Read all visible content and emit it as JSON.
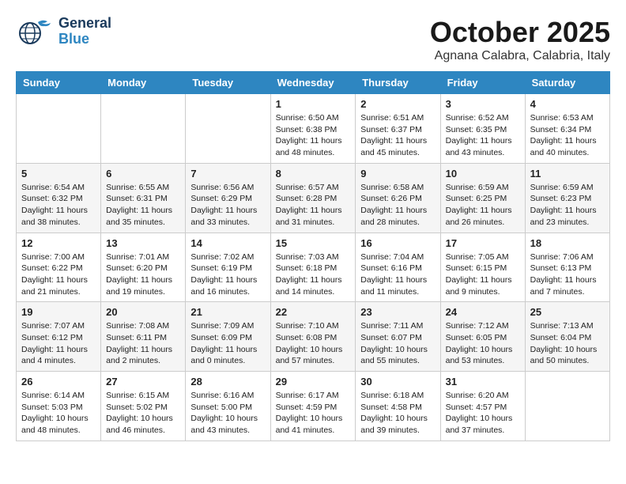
{
  "header": {
    "logo": {
      "line1": "General",
      "line2": "Blue"
    },
    "month": "October 2025",
    "location": "Agnana Calabra, Calabria, Italy"
  },
  "weekdays": [
    "Sunday",
    "Monday",
    "Tuesday",
    "Wednesday",
    "Thursday",
    "Friday",
    "Saturday"
  ],
  "weeks": [
    [
      {
        "day": "",
        "info": ""
      },
      {
        "day": "",
        "info": ""
      },
      {
        "day": "",
        "info": ""
      },
      {
        "day": "1",
        "info": "Sunrise: 6:50 AM\nSunset: 6:38 PM\nDaylight: 11 hours\nand 48 minutes."
      },
      {
        "day": "2",
        "info": "Sunrise: 6:51 AM\nSunset: 6:37 PM\nDaylight: 11 hours\nand 45 minutes."
      },
      {
        "day": "3",
        "info": "Sunrise: 6:52 AM\nSunset: 6:35 PM\nDaylight: 11 hours\nand 43 minutes."
      },
      {
        "day": "4",
        "info": "Sunrise: 6:53 AM\nSunset: 6:34 PM\nDaylight: 11 hours\nand 40 minutes."
      }
    ],
    [
      {
        "day": "5",
        "info": "Sunrise: 6:54 AM\nSunset: 6:32 PM\nDaylight: 11 hours\nand 38 minutes."
      },
      {
        "day": "6",
        "info": "Sunrise: 6:55 AM\nSunset: 6:31 PM\nDaylight: 11 hours\nand 35 minutes."
      },
      {
        "day": "7",
        "info": "Sunrise: 6:56 AM\nSunset: 6:29 PM\nDaylight: 11 hours\nand 33 minutes."
      },
      {
        "day": "8",
        "info": "Sunrise: 6:57 AM\nSunset: 6:28 PM\nDaylight: 11 hours\nand 31 minutes."
      },
      {
        "day": "9",
        "info": "Sunrise: 6:58 AM\nSunset: 6:26 PM\nDaylight: 11 hours\nand 28 minutes."
      },
      {
        "day": "10",
        "info": "Sunrise: 6:59 AM\nSunset: 6:25 PM\nDaylight: 11 hours\nand 26 minutes."
      },
      {
        "day": "11",
        "info": "Sunrise: 6:59 AM\nSunset: 6:23 PM\nDaylight: 11 hours\nand 23 minutes."
      }
    ],
    [
      {
        "day": "12",
        "info": "Sunrise: 7:00 AM\nSunset: 6:22 PM\nDaylight: 11 hours\nand 21 minutes."
      },
      {
        "day": "13",
        "info": "Sunrise: 7:01 AM\nSunset: 6:20 PM\nDaylight: 11 hours\nand 19 minutes."
      },
      {
        "day": "14",
        "info": "Sunrise: 7:02 AM\nSunset: 6:19 PM\nDaylight: 11 hours\nand 16 minutes."
      },
      {
        "day": "15",
        "info": "Sunrise: 7:03 AM\nSunset: 6:18 PM\nDaylight: 11 hours\nand 14 minutes."
      },
      {
        "day": "16",
        "info": "Sunrise: 7:04 AM\nSunset: 6:16 PM\nDaylight: 11 hours\nand 11 minutes."
      },
      {
        "day": "17",
        "info": "Sunrise: 7:05 AM\nSunset: 6:15 PM\nDaylight: 11 hours\nand 9 minutes."
      },
      {
        "day": "18",
        "info": "Sunrise: 7:06 AM\nSunset: 6:13 PM\nDaylight: 11 hours\nand 7 minutes."
      }
    ],
    [
      {
        "day": "19",
        "info": "Sunrise: 7:07 AM\nSunset: 6:12 PM\nDaylight: 11 hours\nand 4 minutes."
      },
      {
        "day": "20",
        "info": "Sunrise: 7:08 AM\nSunset: 6:11 PM\nDaylight: 11 hours\nand 2 minutes."
      },
      {
        "day": "21",
        "info": "Sunrise: 7:09 AM\nSunset: 6:09 PM\nDaylight: 11 hours\nand 0 minutes."
      },
      {
        "day": "22",
        "info": "Sunrise: 7:10 AM\nSunset: 6:08 PM\nDaylight: 10 hours\nand 57 minutes."
      },
      {
        "day": "23",
        "info": "Sunrise: 7:11 AM\nSunset: 6:07 PM\nDaylight: 10 hours\nand 55 minutes."
      },
      {
        "day": "24",
        "info": "Sunrise: 7:12 AM\nSunset: 6:05 PM\nDaylight: 10 hours\nand 53 minutes."
      },
      {
        "day": "25",
        "info": "Sunrise: 7:13 AM\nSunset: 6:04 PM\nDaylight: 10 hours\nand 50 minutes."
      }
    ],
    [
      {
        "day": "26",
        "info": "Sunrise: 6:14 AM\nSunset: 5:03 PM\nDaylight: 10 hours\nand 48 minutes."
      },
      {
        "day": "27",
        "info": "Sunrise: 6:15 AM\nSunset: 5:02 PM\nDaylight: 10 hours\nand 46 minutes."
      },
      {
        "day": "28",
        "info": "Sunrise: 6:16 AM\nSunset: 5:00 PM\nDaylight: 10 hours\nand 43 minutes."
      },
      {
        "day": "29",
        "info": "Sunrise: 6:17 AM\nSunset: 4:59 PM\nDaylight: 10 hours\nand 41 minutes."
      },
      {
        "day": "30",
        "info": "Sunrise: 6:18 AM\nSunset: 4:58 PM\nDaylight: 10 hours\nand 39 minutes."
      },
      {
        "day": "31",
        "info": "Sunrise: 6:20 AM\nSunset: 4:57 PM\nDaylight: 10 hours\nand 37 minutes."
      },
      {
        "day": "",
        "info": ""
      }
    ]
  ]
}
